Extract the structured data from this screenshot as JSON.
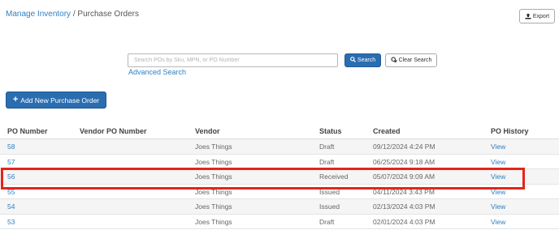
{
  "breadcrumb": {
    "parent": "Manage Inventory",
    "separator": " / ",
    "current": "Purchase Orders"
  },
  "toolbar": {
    "export_label": "Export",
    "export_icon": "export-icon"
  },
  "search": {
    "placeholder": "Search POs by Sku, MPN, or PO Number",
    "value": "",
    "search_label": "Search",
    "clear_label": "Clear Search",
    "advanced_label": "Advanced Search"
  },
  "actions": {
    "add_label": "Add New Purchase Order"
  },
  "table": {
    "headers": {
      "po_number": "PO Number",
      "vendor_po": "Vendor PO Number",
      "vendor": "Vendor",
      "status": "Status",
      "created": "Created",
      "history": "PO History"
    },
    "rows": [
      {
        "po": "58",
        "vendor_po": "",
        "vendor": "Joes Things",
        "status": "Draft",
        "created": "09/12/2024 4:24 PM",
        "history": "View"
      },
      {
        "po": "57",
        "vendor_po": "",
        "vendor": "Joes Things",
        "status": "Draft",
        "created": "06/25/2024 9:18 AM",
        "history": "View"
      },
      {
        "po": "56",
        "vendor_po": "",
        "vendor": "Joes Things",
        "status": "Received",
        "created": "05/07/2024 9:09 AM",
        "history": "View"
      },
      {
        "po": "55",
        "vendor_po": "",
        "vendor": "Joes Things",
        "status": "Issued",
        "created": "04/11/2024 3:43 PM",
        "history": "View"
      },
      {
        "po": "54",
        "vendor_po": "",
        "vendor": "Joes Things",
        "status": "Issued",
        "created": "02/13/2024 4:03 PM",
        "history": "View"
      },
      {
        "po": "53",
        "vendor_po": "",
        "vendor": "Joes Things",
        "status": "Draft",
        "created": "02/01/2024 4:03 PM",
        "history": "View"
      }
    ]
  },
  "colors": {
    "link": "#2f7fc1",
    "primary": "#2a6db0",
    "highlight": "#e3261a"
  }
}
